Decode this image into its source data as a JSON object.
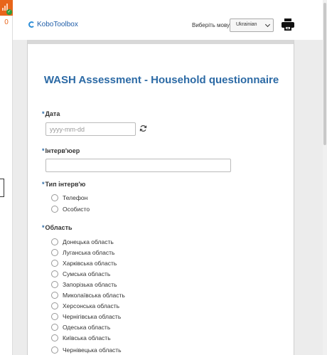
{
  "sidebar": {
    "queue_count": "0"
  },
  "header": {
    "logo_text": "KoboToolbox",
    "language_label": "Виберіть мову",
    "language_selected": "Ukrainian",
    "print_icon": "printer-icon"
  },
  "form": {
    "title": "WASH Assessment - Household questionnaire",
    "required_marker": "*",
    "date": {
      "label": "Дата",
      "placeholder": "yyyy-mm-dd",
      "refresh_icon": "refresh-icon"
    },
    "interviewer": {
      "label": "Інтерв'юер",
      "value": ""
    },
    "interview_type": {
      "label": "Тип інтерв'ю",
      "options": [
        "Телефон",
        "Особисто"
      ]
    },
    "region": {
      "label": "Область",
      "options": [
        "Донецька область",
        "Луганська область",
        "Харківська область",
        "Сумська область",
        "Запорізька область",
        "Миколаївська область",
        "Херсонська область",
        "Чернігівська область",
        "Одеська область",
        "Київська область",
        "Чернівецька область"
      ]
    }
  },
  "colors": {
    "accent": "#2c6aa5",
    "status_tile": "#e8651a",
    "status_ok": "#2e9d3a"
  }
}
